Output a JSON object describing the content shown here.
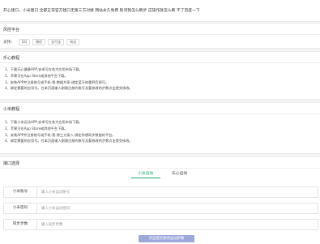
{
  "notice": {
    "text": "开心建口，小米建口 全部正常官方建口无第三方对接 网站永久免费 别问我怎么刷步 这操作就怎么刷 不了百度一下"
  },
  "payment": {
    "title": "风控平台",
    "label": "支持：",
    "options": [
      "QQ",
      "微信",
      "支付宝",
      "淘宝"
    ]
  },
  "section_a": {
    "title": "乐心教程",
    "steps": [
      "1、下载乐心健康APP,安卓可在各大应用市场下载。",
      "2、苹果可在App Store或其他平台下载。",
      "3、安装APP并注册账号或手机-我-数据共享-绑定蓝牙体重秤后即可。",
      "4、绑定需要的应用号。在本页面输入刚刚注册的账号及要修改的步数点击提交修改。"
    ]
  },
  "section_b": {
    "title": "小米教程",
    "steps": [
      "1、下载小米运动APP,安卓可在各大应用市场下载。",
      "2、苹果可在App Store或其他平台下载。",
      "3、安装APP并注册账号或手机-我-第三方接入-绑定你想同步数据的平台。",
      "4、绑定需要的应用号。在本页面输入刚刚注册的账号及要修改的步数点击提交修改。"
    ]
  },
  "interface": {
    "title": "接口选择",
    "tabs": [
      "小米运动",
      "乐心运动"
    ],
    "fields": {
      "account": {
        "label": "小米账号",
        "placeholder": "输入小米运动账号"
      },
      "password": {
        "label": "小米密码",
        "placeholder": "输入小米运动密码"
      },
      "steps": {
        "label": "同步步数",
        "placeholder": "输入同步步数"
      }
    },
    "submit_label": "点击提交修改运动步数"
  }
}
